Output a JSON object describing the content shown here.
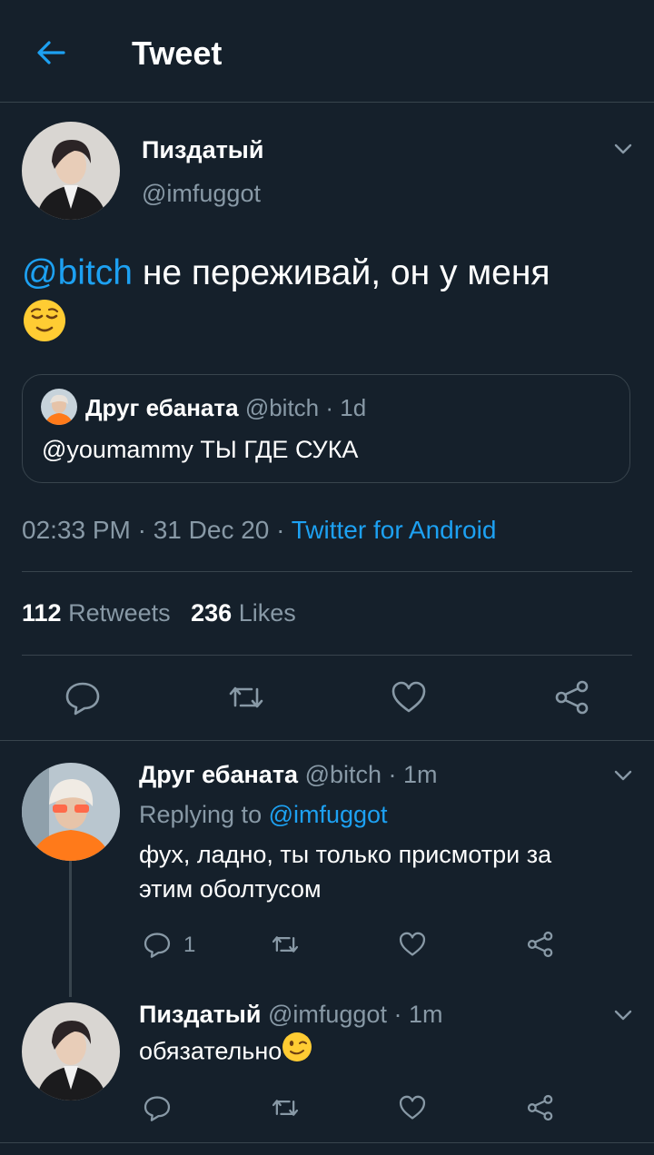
{
  "header": {
    "back_icon": "arrow-left-icon",
    "title": "Tweet"
  },
  "tweet": {
    "author_name": "Пиздатый",
    "author_handle": "@imfuggot",
    "mention": "@bitch",
    "text": " не переживай, он у меня",
    "emoji_icon": "relieved-face-emoji",
    "quote": {
      "author_name": "Друг ебаната",
      "author_handle": "@bitch",
      "time": "· 1d",
      "text": "@youmammy ТЫ ГДЕ СУКА"
    },
    "timestamp": "02:33 PM · 31 Dec 20 · ",
    "source": "Twitter for Android",
    "retweets_count": "112",
    "retweets_label": " Retweets",
    "likes_count": "236",
    "likes_label": " Likes"
  },
  "replies": [
    {
      "author_name": "Друг ебаната",
      "author_handle": "@bitch",
      "time": "· 1m",
      "replying_prefix": "Replying to ",
      "replying_to": "@imfuggot",
      "text_line1": "фух, ладно, ты только присмотри за",
      "text_line2": "этим оболтусом",
      "reply_count": "1"
    },
    {
      "author_name": "Пиздатый",
      "author_handle": "@imfuggot",
      "time": "· 1m",
      "text": "обязательно",
      "emoji_icon": "winking-face-emoji"
    }
  ],
  "colors": {
    "background": "#15202b",
    "accent": "#1da1f2",
    "muted": "#8899a6",
    "divider": "#38444d"
  }
}
